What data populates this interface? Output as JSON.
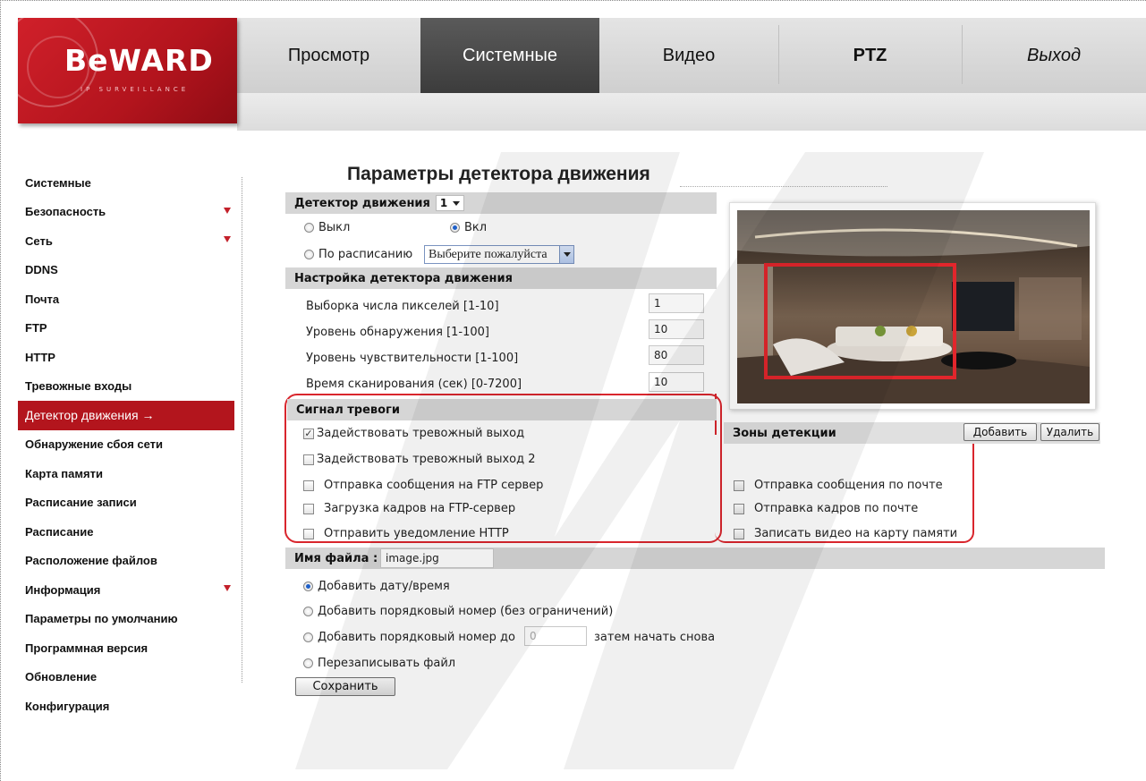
{
  "logo": {
    "text": "BeWARD",
    "sub": "IP SURVEILLANCE"
  },
  "nav": {
    "items": [
      {
        "label": "Просмотр"
      },
      {
        "label": "Системные"
      },
      {
        "label": "Видео"
      },
      {
        "label": "PTZ"
      },
      {
        "label": "Выход"
      }
    ],
    "active": "Системные"
  },
  "sidebar": {
    "items": [
      {
        "label": "Системные"
      },
      {
        "label": "Безопасность"
      },
      {
        "label": "Сеть"
      },
      {
        "label": "DDNS"
      },
      {
        "label": "Почта"
      },
      {
        "label": "FTP"
      },
      {
        "label": "HTTP"
      },
      {
        "label": "Тревожные входы"
      },
      {
        "label": "Детектор движения"
      },
      {
        "label": "Обнаружение сбоя сети"
      },
      {
        "label": "Карта памяти"
      },
      {
        "label": "Расписание записи"
      },
      {
        "label": "Расписание"
      },
      {
        "label": "Расположение файлов"
      },
      {
        "label": "Информация"
      },
      {
        "label": "Параметры по умолчанию"
      },
      {
        "label": "Программная версия"
      },
      {
        "label": "Обновление"
      },
      {
        "label": "Конфигурация"
      }
    ],
    "active_arrow": "→"
  },
  "page": {
    "title": "Параметры детектора движения"
  },
  "motion": {
    "header": "Детектор движения",
    "detector_value": "1",
    "off_label": "Выкл",
    "on_label": "Вкл",
    "schedule_label": "По расписанию",
    "schedule_value": "Выберите пожалуйста",
    "mode": "on"
  },
  "settings": {
    "header": "Настройка детектора движения",
    "rows": [
      {
        "label": "Выборка числа пикселей [1-10]",
        "value": "1"
      },
      {
        "label": "Уровень обнаружения [1-100]",
        "value": "10"
      },
      {
        "label": "Уровень чувствительности [1-100]",
        "value": "80"
      },
      {
        "label": "Время сканирования (сек) [0-7200]",
        "value": "10"
      }
    ]
  },
  "alarm": {
    "header": "Сигнал тревоги",
    "out1": {
      "label": "Задействовать тревожный выход",
      "checked": true
    },
    "out2": {
      "label": "Задействовать тревожный выход 2",
      "checked": false
    },
    "left": [
      {
        "label": "Отправка сообщения на FTP сервер",
        "checked": false
      },
      {
        "label": "Загрузка кадров на FTP-сервер",
        "checked": false
      },
      {
        "label": "Отправить уведомление HTTP",
        "checked": false
      }
    ],
    "right": [
      {
        "label": "Отправка сообщения по почте",
        "checked": false
      },
      {
        "label": "Отправка кадров по почте",
        "checked": false
      },
      {
        "label": "Записать видео на карту памяти",
        "checked": false
      }
    ]
  },
  "zones": {
    "label": "Зоны детекции",
    "add": "Добавить",
    "delete": "Удалить"
  },
  "file": {
    "label": "Имя файла :",
    "value": "image.jpg",
    "opt_datetime": "Добавить дату/время",
    "opt_seq_unlimited": "Добавить порядковый номер (без ограничений)",
    "opt_seq_upto": "Добавить порядковый номер до",
    "seq_upto_value": "0",
    "opt_seq_then": "затем начать снова",
    "opt_overwrite": "Перезаписывать файл",
    "selected": "datetime"
  },
  "save_label": "Сохранить",
  "colors": {
    "brand_red": "#b3151d",
    "annotation_red": "#d9262d",
    "section_grey": "#d6d6d6"
  }
}
